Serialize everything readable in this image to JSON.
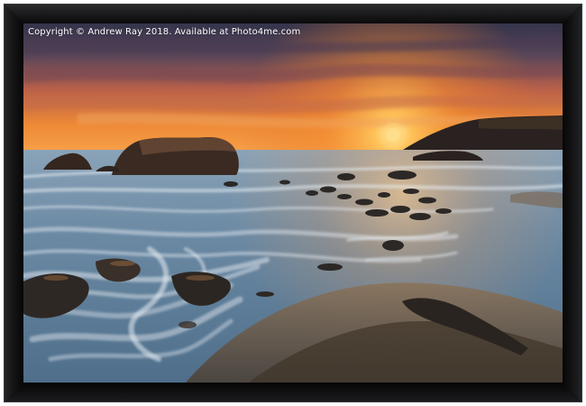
{
  "watermark": {
    "text": "Copyright  © Andrew Ray  2018. Available at Photo4me.com"
  },
  "colors": {
    "frame": "#0d0d0e",
    "frame_edge": "#2a2a2c",
    "sky_top": "#3a3a52",
    "sky_glow": "#f08a2a",
    "sun": "#ffd46a",
    "sea": "#6f8ea8",
    "sand": "#6b5a48"
  }
}
